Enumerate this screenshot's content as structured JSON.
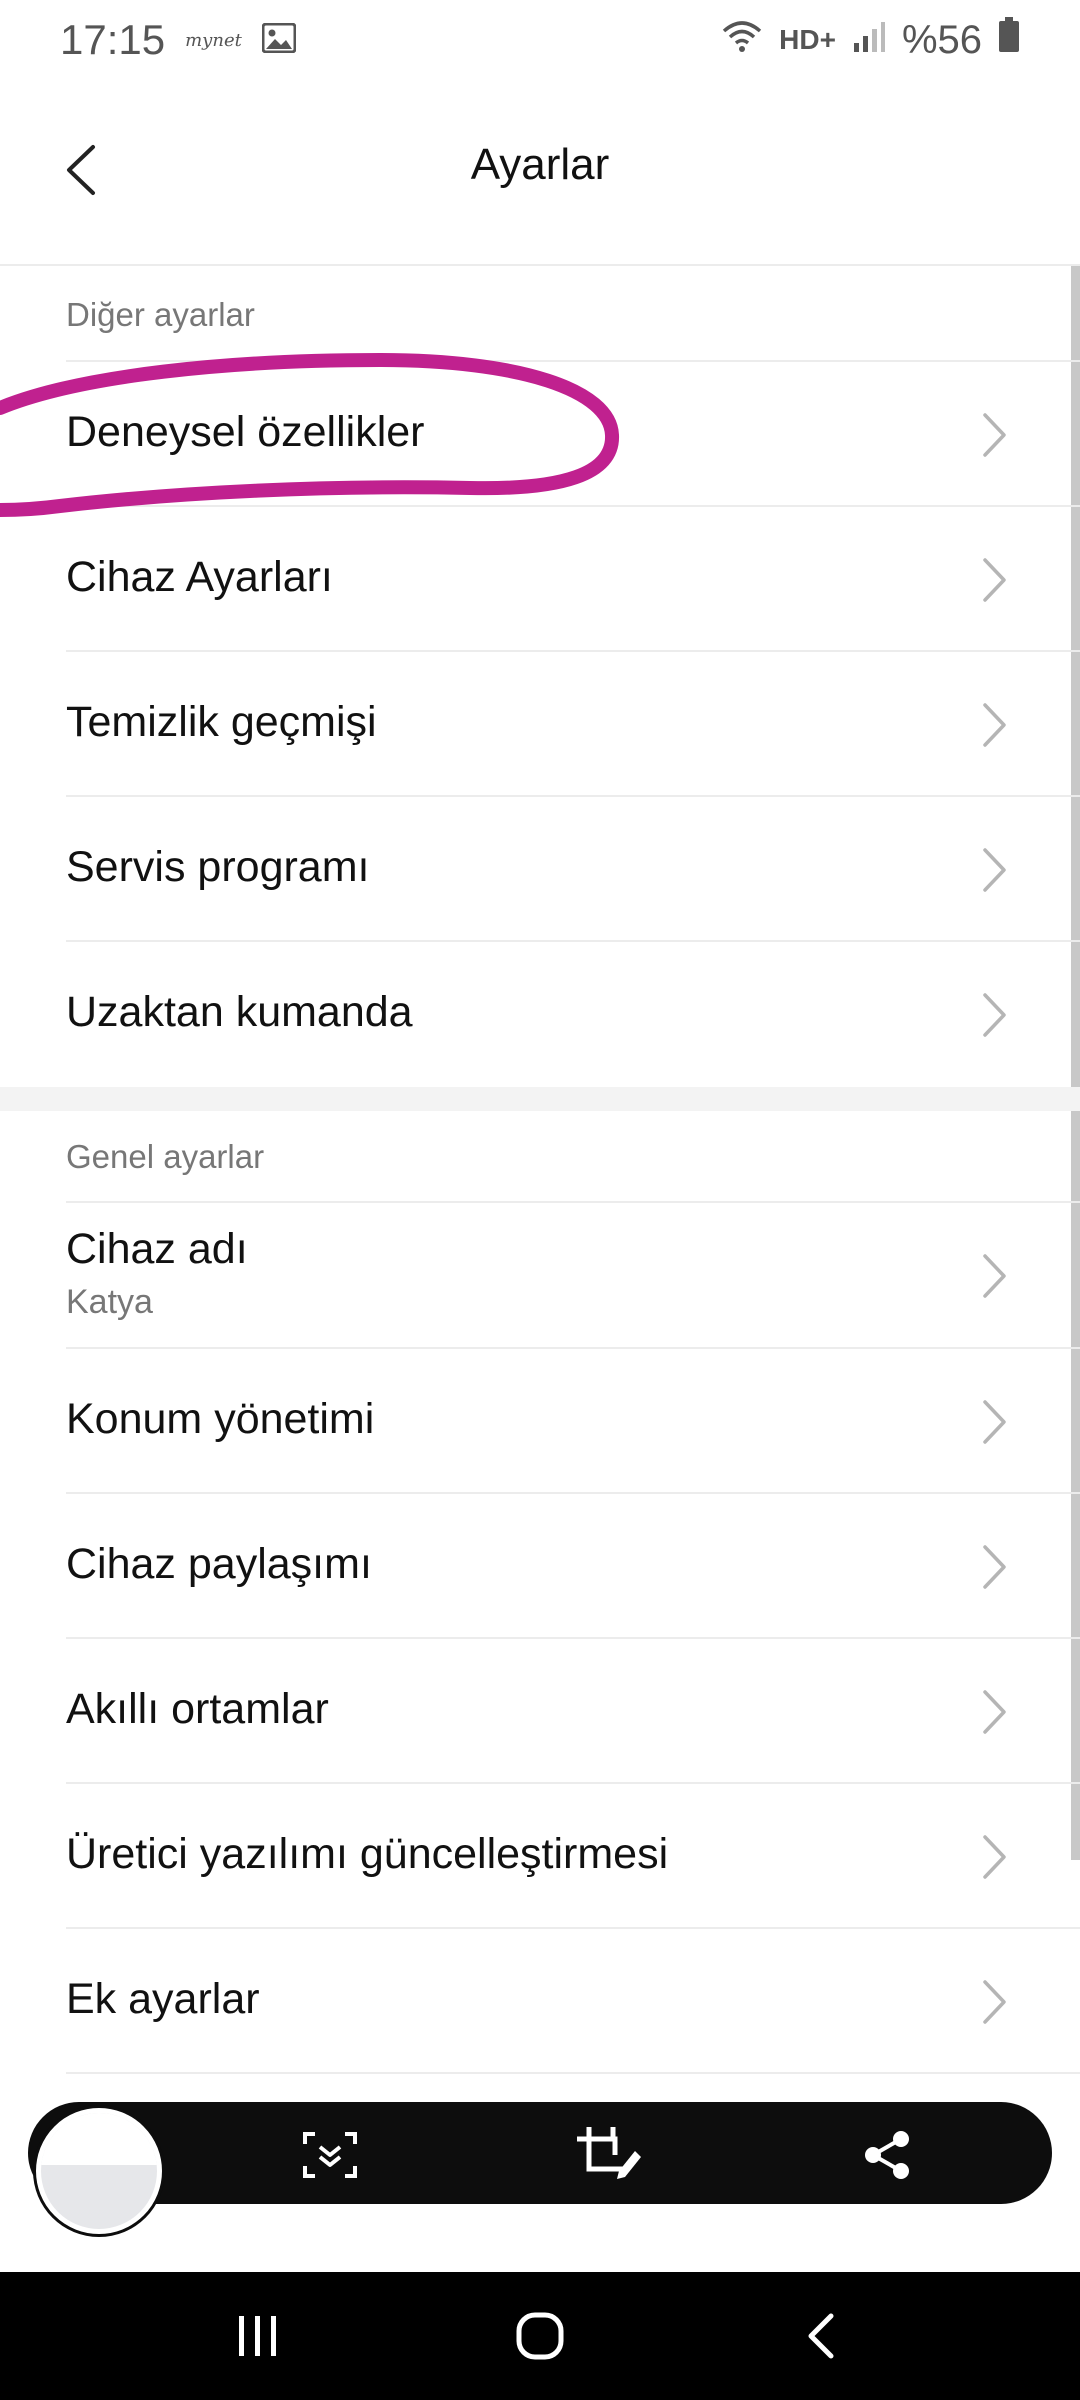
{
  "status_bar": {
    "time": "17:15",
    "carrier_badge": "mynet",
    "network": "HD+",
    "battery": "%56"
  },
  "header": {
    "title": "Ayarlar"
  },
  "sections": {
    "other": {
      "label": "Diğer ayarlar",
      "items": [
        {
          "label": "Deneysel özellikler"
        },
        {
          "label": "Cihaz Ayarları"
        },
        {
          "label": "Temizlik geçmişi"
        },
        {
          "label": "Servis programı"
        },
        {
          "label": "Uzaktan kumanda"
        }
      ]
    },
    "general": {
      "label": "Genel ayarlar",
      "items": [
        {
          "label": "Cihaz adı",
          "value": "Katya"
        },
        {
          "label": "Konum yönetimi"
        },
        {
          "label": "Cihaz paylaşımı"
        },
        {
          "label": "Akıllı ortamlar"
        },
        {
          "label": "Üretici yazılımı güncelleştirmesi"
        },
        {
          "label": "Ek ayarlar"
        }
      ]
    }
  },
  "screenshot_toolbar": {
    "icons": [
      "scroll-capture-icon",
      "crop-edit-icon",
      "share-icon"
    ]
  },
  "nav_bar": {
    "icons": [
      "recent-apps-icon",
      "home-icon",
      "back-icon"
    ]
  },
  "colors": {
    "annotation": "#c0218f",
    "divider": "#ececec",
    "section_label": "#777777"
  }
}
